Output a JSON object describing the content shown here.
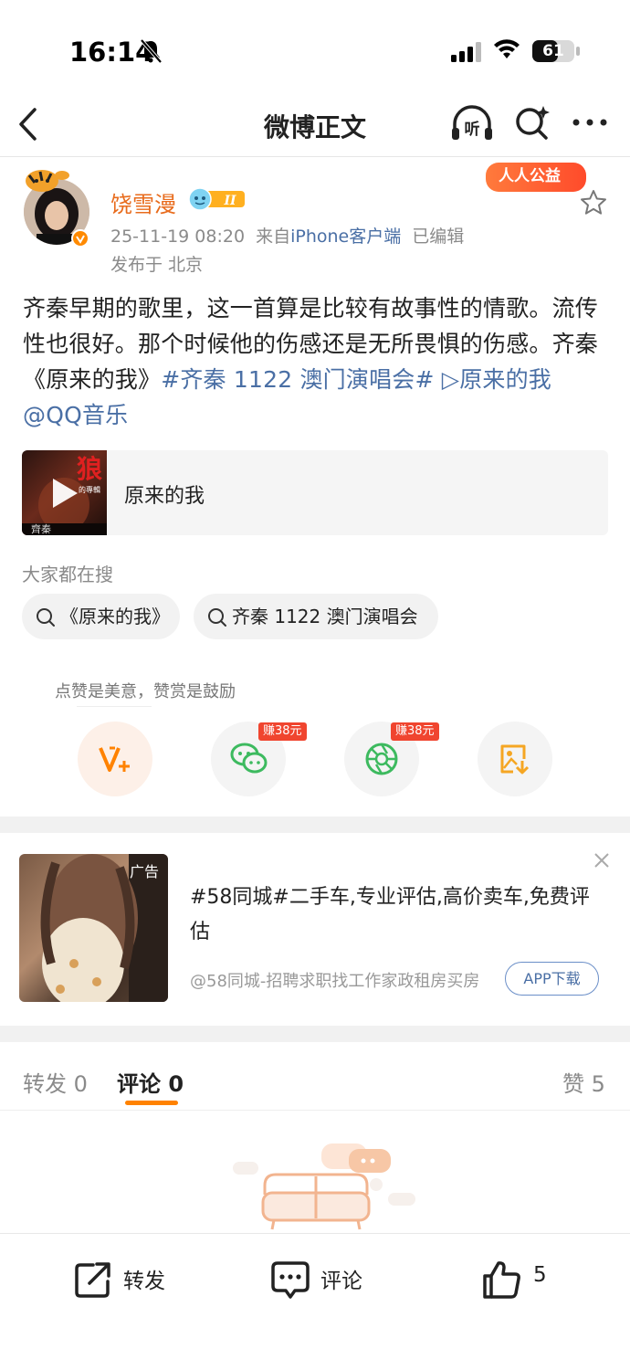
{
  "status_bar": {
    "time": "16:14",
    "battery": "61",
    "battery_level": 0.61
  },
  "nav": {
    "title": "微博正文"
  },
  "post": {
    "author": "饶雪漫",
    "badge": "人人公益",
    "level": "II",
    "timestamp": "25-11-19 08:20",
    "source_prefix": "来自",
    "source_client": "iPhone客户端",
    "edited": "已编辑",
    "location": "发布于 北京",
    "text_main": "齐秦早期的歌里，这一首算是比较有故事性的情歌。流传性也很好。那个时候他的伤感还是无所畏惧的伤感。齐秦《原来的我》",
    "hashtag": "#齐秦 1122 澳门演唱会#",
    "music_link": " ▷原来的我",
    "mention": " @QQ音乐"
  },
  "music_card": {
    "title": "原来的我",
    "cover_title": "狼",
    "cover_subtitle": "的專輯",
    "cover_artist": "齊秦"
  },
  "search": {
    "title": "大家都在搜",
    "chips": [
      "《原来的我》",
      "齐秦 1122 澳门演唱会"
    ]
  },
  "reward": {
    "hint": "点赞是美意，赞赏是鼓励",
    "earn_badges": [
      "赚38元",
      "赚38元"
    ]
  },
  "ad": {
    "label": "广告",
    "title": "#58同城#二手车,专业评估,高价卖车,免费评估",
    "source": "@58同城-招聘求职找工作家政租房买房",
    "download": "APP下载"
  },
  "tabs": [
    {
      "label": "转发",
      "count": "0"
    },
    {
      "label": "评论",
      "count": "0"
    },
    {
      "label": "赞",
      "count": "5"
    }
  ],
  "bottom_bar": {
    "repost": "转发",
    "comment": "评论",
    "like_count": "5"
  },
  "colors": {
    "accent": "#ff8200",
    "link": "#4a6fa5",
    "name": "#e86b1c"
  }
}
